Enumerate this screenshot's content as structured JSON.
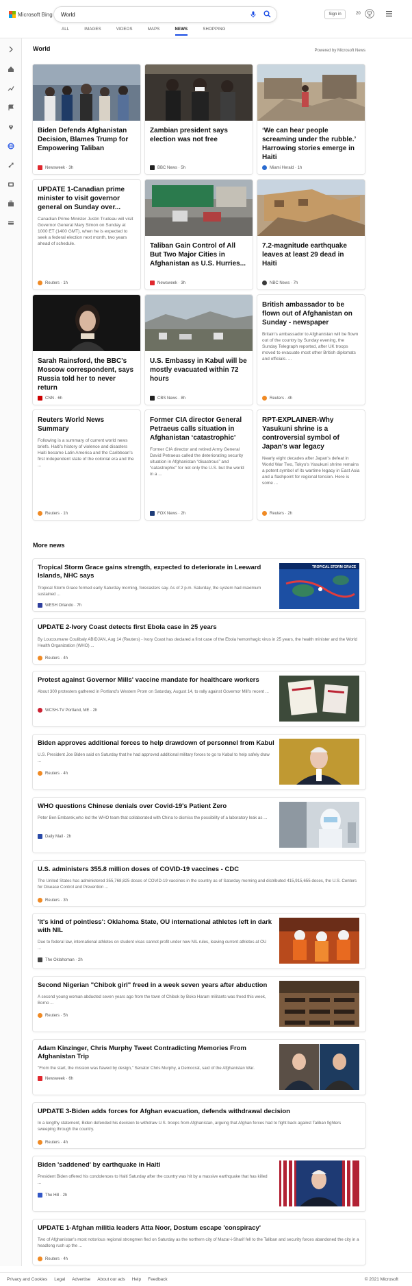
{
  "brand": {
    "name": "Microsoft Bing"
  },
  "search": {
    "query": "World"
  },
  "header": {
    "sign_in": "Sign in",
    "rewards_count": "20"
  },
  "tabs": [
    {
      "label": "ALL"
    },
    {
      "label": "IMAGES"
    },
    {
      "label": "VIDEOS"
    },
    {
      "label": "MAPS"
    },
    {
      "label": "NEWS",
      "active": true
    },
    {
      "label": "SHOPPING"
    }
  ],
  "section": {
    "title": "World",
    "powered_by": "Powered by Microsoft News"
  },
  "cards": [
    {
      "title": "Biden Defends Afghanistan Decision, Blames Trump for Empowering Taliban",
      "source": "Newsweek",
      "time": "3h",
      "meta": "Newsweek · 3h",
      "badge_color": "#e0282e",
      "image": "crowd-airport"
    },
    {
      "title": "Zambian president says election was not free",
      "source": "BBC News",
      "time": "5h",
      "meta": "BBC News · 5h",
      "badge_color": "#222222",
      "image": "masked-crowd"
    },
    {
      "title": "‘We can hear people screaming under the rubble.’ Harrowing stories emerge in Haiti",
      "source": "Miami Herald",
      "time": "1h",
      "meta": "Miami Herald · 1h",
      "badge_color": "#2a6bd0",
      "image": "rubble"
    },
    {
      "title": "UPDATE 1-Canadian prime minister to visit governor general on Sunday over...",
      "abstract": "Canadian Prime Minister Justin Trudeau will visit Governor General Mary Simon on Sunday at 1000 ET (1400 GMT), when he is expected to seek a federal election next month, two years ahead of schedule.",
      "source": "Reuters",
      "time": "1h",
      "meta": "Reuters · 1h",
      "badge_color": "#f08a24"
    },
    {
      "title": "Taliban Gain Control of All But Two Major Cities in Afghanistan as U.S. Hurries...",
      "source": "Newsweek",
      "time": "3h",
      "meta": "Newsweek · 3h",
      "badge_color": "#e0282e",
      "image": "kabul-street"
    },
    {
      "title": "7.2-magnitude earthquake leaves at least 29 dead in Haiti",
      "source": "NBC News",
      "time": "7h",
      "meta": "NBC News · 7h",
      "badge_color": "#3a3a3a",
      "image": "collapsed-building"
    },
    {
      "title": "Sarah Rainsford, the BBC's Moscow correspondent, says Russia told her to never return",
      "source": "CNN",
      "time": "6h",
      "meta": "CNN · 6h",
      "badge_color": "#cc0000",
      "image": "portrait-woman"
    },
    {
      "title": "U.S. Embassy in Kabul will be mostly evacuated within 72 hours",
      "source": "CBS News",
      "time": "8h",
      "meta": "CBS News · 8h",
      "badge_color": "#222222",
      "image": "kabul-skyline"
    },
    {
      "title": "British ambassador to be flown out of Afghanistan on Sunday - newspaper",
      "abstract": "Britain's ambassador to Afghanistan will be flown out of the country by Sunday evening, the Sunday Telegraph reported, after UK troops moved to evacuate most other British diplomats and officials. ...",
      "source": "Reuters",
      "time": "4h",
      "meta": "Reuters · 4h",
      "badge_color": "#f08a24"
    },
    {
      "title": "Reuters World News Summary",
      "abstract": "Following is a summary of current world news briefs. Haiti's history of violence and disasters Haiti became Latin America and the Caribbean's first independent state of the colonial era and the ...",
      "source": "Reuters",
      "time": "1h",
      "meta": "Reuters · 1h",
      "badge_color": "#f08a24"
    },
    {
      "title": "Former CIA director General Petraeus calls situation in Afghanistan ‘catastrophic’",
      "abstract": "Former CIA director and retired Army General David Petraeus called the deteriorating security situation in Afghanistan “disastrous” and “catastrophic” for not only the U.S. but the world in a ...",
      "source": "FOX News",
      "time": "2h",
      "meta": "FOX News · 2h",
      "badge_color": "#1d3c78"
    },
    {
      "title": "RPT-EXPLAINER-Why Yasukuni shrine is a controversial symbol of Japan's war legacy",
      "abstract": "Nearly eight decades after Japan's defeat in World War Two, Tokyo's Yasukuni shrine remains a potent symbol of its wartime legacy in East Asia and a flashpoint for regional tension. Here is some ...",
      "source": "Reuters",
      "time": "2h",
      "meta": "Reuters · 2h",
      "badge_color": "#f08a24"
    }
  ],
  "more_news": {
    "title": "More news",
    "items": [
      {
        "title": "Tropical Storm Grace gains strength, expected to deteriorate in Leeward Islands, NHC says",
        "abstract": "Tropical Storm Grace formed early Saturday morning, forecasters say. As of 2 p.m. Saturday, the system had maximum sustained ...",
        "meta": "WESH Orlando · 7h",
        "badge_color": "#2f3f9e",
        "image": "storm-map",
        "thumb_caption": "TROPICAL STORM GRACE"
      },
      {
        "title": "UPDATE 2-Ivory Coast detects first Ebola case in 25 years",
        "abstract": "By Loucoumane Coulibaly ABIDJAN, Aug 14 (Reuters) - Ivory Coast has declared a first case of the Ebola hemorrhagic virus in 25 years, the health minister and the World Health Organization (WHO) ...",
        "meta": "Reuters · 4h",
        "badge_color": "#f08a24"
      },
      {
        "title": "Protest against Governor Mills' vaccine mandate for healthcare workers",
        "abstract": "About 300 protesters gathered in Portland's Western Prom on Saturday, August 14, to rally against Governor Mill's recent ...",
        "meta": "WCSH-TV Portland, ME · 2h",
        "badge_color": "#cc2233",
        "image": "protest-signs"
      },
      {
        "title": "Biden approves additional forces to help drawdown of personnel from Kabul",
        "abstract": "U.S. President Joe Biden said on Saturday that he had approved additional military forces to go to Kabul to help safely draw ...",
        "meta": "Reuters · 4h",
        "badge_color": "#f08a24",
        "image": "biden-portrait"
      },
      {
        "title": "WHO questions Chinese denials over Covid-19's Patient Zero",
        "abstract": "Peter Ben Embarek,who led the WHO team that collaborated with China to dismiss the possibility of a laboratory leak as ...",
        "meta": "Daily Mail · 2h",
        "badge_color": "#2a4aa8",
        "image": "lab-worker"
      },
      {
        "title": "U.S. administers 355.8 million doses of COVID-19 vaccines - CDC",
        "abstract": "The United States has administered 355,768,825 doses of COVID-19 vaccines in the country as of Saturday morning and distributed 415,915,655 doses, the U.S. Centers for Disease Control and Prevention ...",
        "meta": "Reuters · 3h",
        "badge_color": "#f08a24"
      },
      {
        "title": "'It's kind of pointless': Oklahoma State, OU international athletes left in dark with NIL",
        "abstract": "Due to federal law, international athletes on student visas cannot profit under new NIL rules, leaving current athletes at OU ...",
        "meta": "The Oklahoman · 2h",
        "badge_color": "#444444",
        "image": "football-players"
      },
      {
        "title": "Second Nigerian \"Chibok girl\" freed in a week seven years after abduction",
        "abstract": "A second young woman abducted seven years ago from the town of Chibok by Boko Haram militants was freed this week, Borno ...",
        "meta": "Reuters · 5h",
        "badge_color": "#f08a24",
        "image": "classroom"
      },
      {
        "title": "Adam Kinzinger, Chris Murphy Tweet Contradicting Memories From Afghanistan Trip",
        "abstract": "\"From the start, the mission was flawed by design,\" Senator Chris Murphy, a Democrat, said of the Afghanistan War.",
        "meta": "Newsweek · 6h",
        "badge_color": "#e0282e",
        "image": "two-politicians"
      },
      {
        "title": "UPDATE 3-Biden adds forces for Afghan evacuation, defends withdrawal decision",
        "abstract": "In a lengthy statement, Biden defended his decision to withdraw U.S. troops from Afghanistan, arguing that Afghan forces had to fight back against Taliban fighters sweeping through the country.",
        "meta": "Reuters · 4h",
        "badge_color": "#f08a24"
      },
      {
        "title": "Biden 'saddened' by earthquake in Haiti",
        "abstract": "President Biden offered his condolences to Haiti Saturday after the country was hit by a massive earthquake that has killed ...",
        "meta": "The Hill · 2h",
        "badge_color": "#3357c6",
        "image": "biden-flags"
      },
      {
        "title": "UPDATE 1-Afghan militia leaders Atta Noor, Dostum escape 'conspiracy'",
        "abstract": "Two of Afghanistan's most notorious regional strongmen fled on Saturday as the northern city of Mazar-i-Sharif fell to the Taliban and security forces abandoned the city in a headlong rush up the ...",
        "meta": "Reuters · 4h",
        "badge_color": "#f08a24"
      }
    ]
  },
  "footer": {
    "links": [
      "Privacy and Cookies",
      "Legal",
      "Advertise",
      "About our ads",
      "Help",
      "Feedback"
    ],
    "copyright": "© 2021 Microsoft"
  }
}
